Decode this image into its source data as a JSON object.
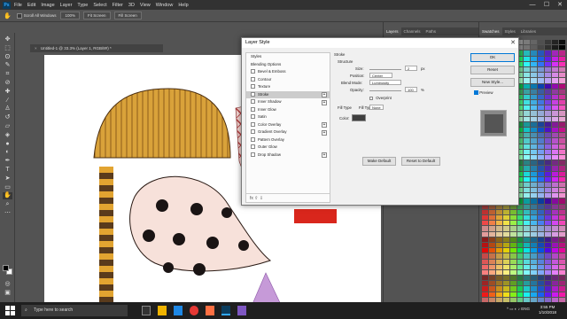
{
  "menubar": {
    "logo": "Ps",
    "items": [
      "File",
      "Edit",
      "Image",
      "Layer",
      "Type",
      "Select",
      "Filter",
      "3D",
      "View",
      "Window",
      "Help"
    ],
    "minimize": "—",
    "maximize": "☐",
    "close": "✕"
  },
  "optbar": {
    "scroll_all": "Scroll All Windows",
    "zoom": "100%",
    "fit_screen": "Fit Screen",
    "fill_screen": "Fill Screen"
  },
  "document": {
    "tab_title": "Untitled-1 @ 33.3% (Layer 1, RGB/8#) *",
    "tab_close": "×"
  },
  "layers_panel": {
    "tabs": [
      "Layers",
      "Channels",
      "Paths"
    ]
  },
  "swatch_panel": {
    "tabs": [
      "Swatches",
      "Styles",
      "Libraries"
    ]
  },
  "dialog": {
    "title": "Layer Style",
    "close": "✕",
    "left_items": [
      {
        "label": "Styles",
        "check": false,
        "plus": false
      },
      {
        "label": "Blending Options",
        "check": false,
        "plus": false
      },
      {
        "label": "Bevel & Emboss",
        "check": true,
        "plus": false
      },
      {
        "label": "Contour",
        "check": true,
        "plus": false
      },
      {
        "label": "Texture",
        "check": true,
        "plus": false
      },
      {
        "label": "Stroke",
        "check": true,
        "plus": true,
        "selected": true
      },
      {
        "label": "Inner Shadow",
        "check": true,
        "plus": true
      },
      {
        "label": "Inner Glow",
        "check": true,
        "plus": false
      },
      {
        "label": "Satin",
        "check": true,
        "plus": false
      },
      {
        "label": "Color Overlay",
        "check": true,
        "plus": true
      },
      {
        "label": "Gradient Overlay",
        "check": true,
        "plus": true
      },
      {
        "label": "Pattern Overlay",
        "check": true,
        "plus": false
      },
      {
        "label": "Outer Glow",
        "check": true,
        "plus": false
      },
      {
        "label": "Drop Shadow",
        "check": true,
        "plus": true
      }
    ],
    "footer": "fx  ⇧  ⇩",
    "stroke": {
      "title": "Stroke",
      "structure": "Structure",
      "size_label": "Size:",
      "size_value": "2",
      "size_unit": "px",
      "position_label": "Position:",
      "position_value": "Center",
      "blend_label": "Blend Mode:",
      "blend_value": "Luminosity",
      "opacity_label": "Opacity:",
      "opacity_value": "100",
      "opacity_unit": "%",
      "overprint": "Overprint",
      "fill_type_label": "Fill Type:",
      "fill_type_value": "None",
      "color_label": "Color:",
      "make_default": "Make Default",
      "reset_default": "Reset to Default"
    },
    "buttons": {
      "ok": "OK",
      "reset": "Reset",
      "new_style": "New Style...",
      "preview": "Preview"
    }
  },
  "taskbar": {
    "search": "Type here to search",
    "lang": "ENG",
    "time": "3:55 PM",
    "date": "1/10/2018"
  }
}
